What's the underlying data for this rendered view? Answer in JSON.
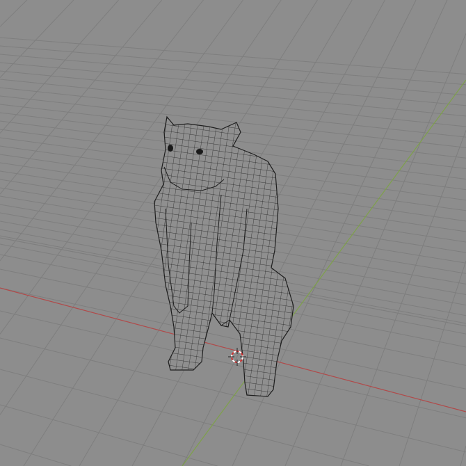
{
  "colors": {
    "background": "#8d8d8d",
    "grid": "#7e7e7e",
    "x_axis": "#b04a4a",
    "y_axis": "#7ea14a",
    "mesh_fill": "#8f8f8f",
    "wire": "#1e1e1e",
    "cursor_red": "#d03030",
    "cursor_white": "#ffffff"
  }
}
